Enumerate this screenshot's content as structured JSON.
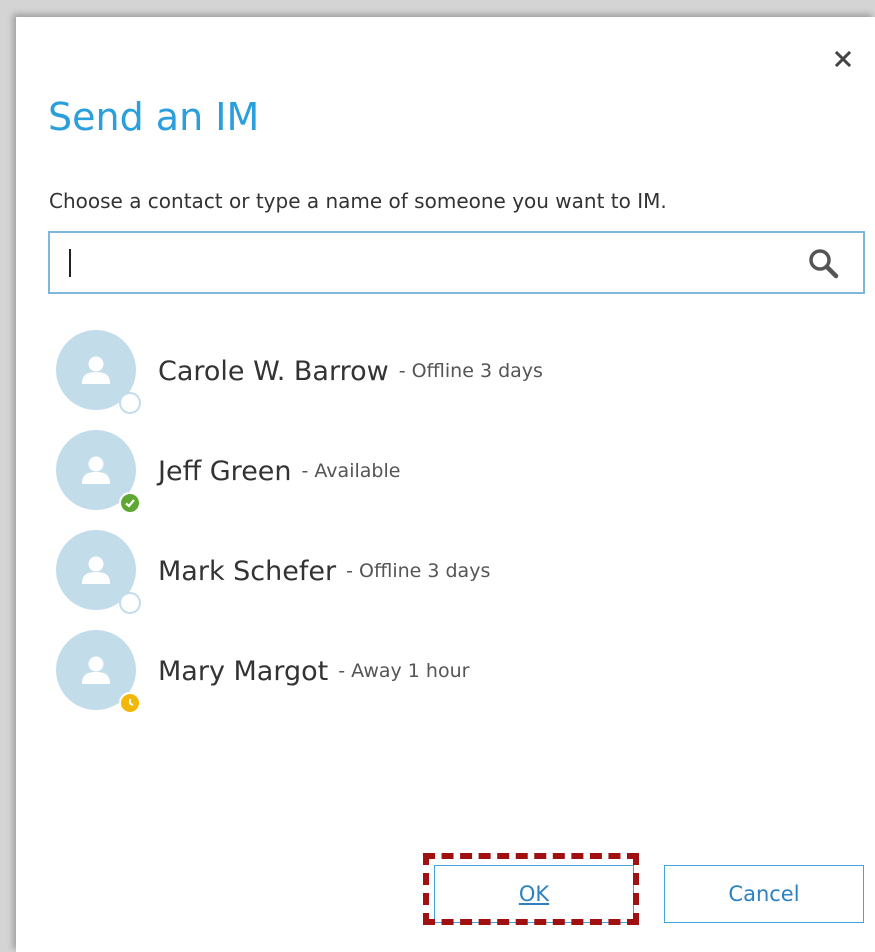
{
  "dialog": {
    "title": "Send an IM",
    "prompt": "Choose a contact or type a name of someone you want to IM.",
    "search": {
      "value": "",
      "placeholder": ""
    },
    "contacts": [
      {
        "name": "Carole W. Barrow",
        "status": "- Offline 3 days",
        "presence": "offline"
      },
      {
        "name": "Jeff Green",
        "status": "- Available",
        "presence": "available"
      },
      {
        "name": "Mark Schefer",
        "status": "- Offline 3 days",
        "presence": "offline"
      },
      {
        "name": "Mary Margot",
        "status": "- Away 1 hour",
        "presence": "away"
      }
    ],
    "ok_label": "OK",
    "cancel_label": "Cancel"
  },
  "colors": {
    "title": "#2a9fdc",
    "accent": "#45a4dc",
    "available": "#5ea732",
    "away": "#f2b807",
    "highlight": "#a01010"
  },
  "icons": {
    "close": "close-icon",
    "search": "search-icon",
    "avatar": "person-icon",
    "available": "checkmark-icon",
    "away": "clock-icon"
  }
}
